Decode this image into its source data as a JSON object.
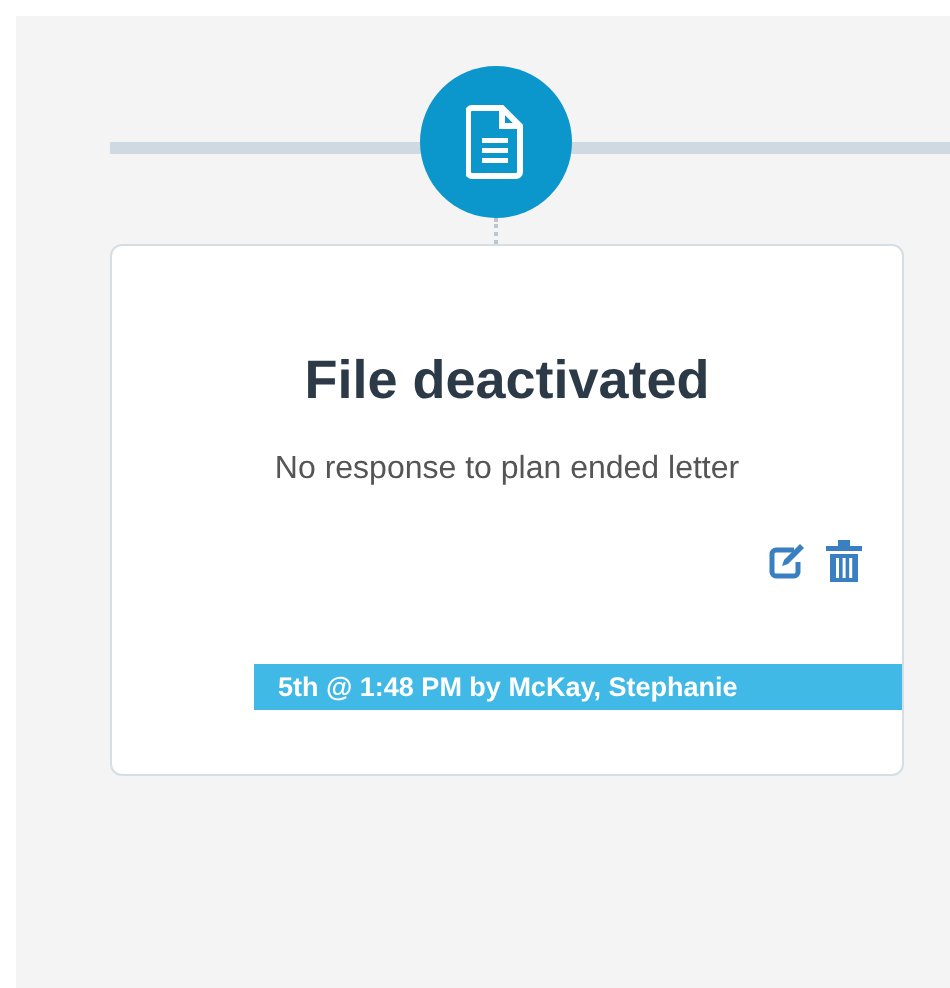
{
  "event": {
    "title": "File deactivated",
    "description": "No response to plan ended letter",
    "footer": "5th @ 1:48 PM by McKay, Stephanie"
  }
}
